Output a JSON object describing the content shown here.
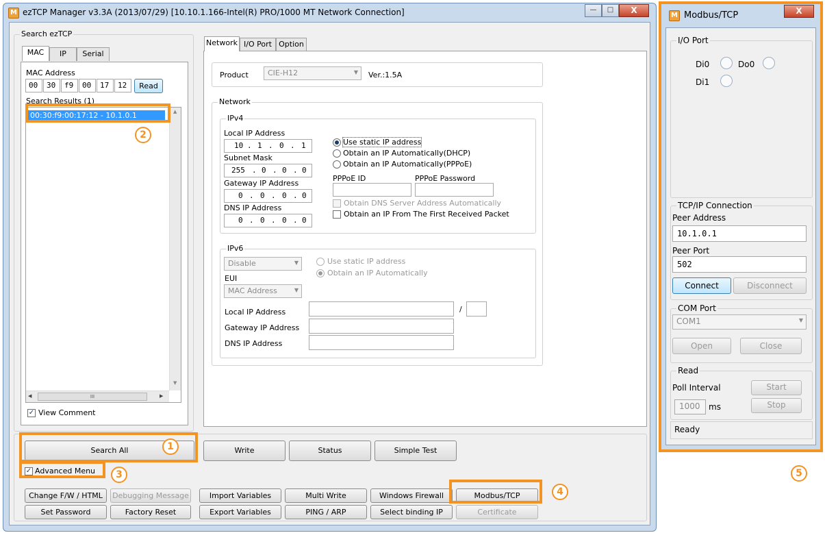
{
  "main_window": {
    "title": "ezTCP Manager v3.3A (2013/07/29) [10.10.1.166-Intel(R) PRO/1000 MT Network Connection]",
    "search": {
      "group_label": "Search ezTCP",
      "tabs": [
        "MAC",
        "IP",
        "Serial"
      ],
      "mac_label": "MAC Address",
      "mac_octets": [
        "00",
        "30",
        "f9",
        "00",
        "17",
        "12"
      ],
      "read_label": "Read",
      "results_label": "Search Results (1)",
      "results": [
        "00:30:f9:00:17:12 - 10.1.0.1"
      ],
      "view_comment": "View Comment",
      "hscroll_mark": "III"
    },
    "tabs": [
      "Network",
      "I/O Port",
      "Option"
    ],
    "product": {
      "label": "Product",
      "value": "CIE-H12",
      "version": "Ver.:1.5A"
    },
    "network": {
      "group_label": "Network",
      "ipv4": {
        "label": "IPv4",
        "local_ip_label": "Local IP Address",
        "local_ip": [
          "10",
          "1",
          "0",
          "1"
        ],
        "subnet_label": "Subnet Mask",
        "subnet": [
          "255",
          "0",
          "0",
          "0"
        ],
        "gateway_label": "Gateway IP Address",
        "gateway": [
          "0",
          "0",
          "0",
          "0"
        ],
        "dns_label": "DNS IP Address",
        "dns": [
          "0",
          "0",
          "0",
          "0"
        ],
        "radio_static": "Use static IP address",
        "radio_dhcp": "Obtain an IP Automatically(DHCP)",
        "radio_pppoe": "Obtain an IP Automatically(PPPoE)",
        "pppoe_id_label": "PPPoE ID",
        "pppoe_pw_label": "PPPoE Password",
        "chk_dns_auto": "Obtain DNS Server Address Automatically",
        "chk_first_packet": "Obtain an IP From The First Received Packet"
      },
      "ipv6": {
        "label": "IPv6",
        "mode": "Disable",
        "eui_label": "EUI",
        "eui": "MAC Address",
        "radio_static": "Use static IP address",
        "radio_auto": "Obtain an IP Automatically",
        "local_ip_label": "Local IP Address",
        "prefix_sep": "/",
        "gateway_label": "Gateway IP Address",
        "dns_label": "DNS IP Address"
      }
    },
    "buttons": {
      "search_all": "Search All",
      "write": "Write",
      "status": "Status",
      "simple_test": "Simple Test",
      "advanced_menu": "Advanced Menu",
      "change_fw": "Change F/W / HTML",
      "debugging": "Debugging Message",
      "import_vars": "Import Variables",
      "multi_write": "Multi Write",
      "win_firewall": "Windows Firewall",
      "modbus_tcp": "Modbus/TCP",
      "set_password": "Set Password",
      "factory_reset": "Factory Reset",
      "export_vars": "Export Variables",
      "ping_arp": "PING / ARP",
      "select_binding": "Select binding IP",
      "certificate": "Certificate"
    }
  },
  "modbus_window": {
    "title": "Modbus/TCP",
    "io_port": {
      "label": "I/O Port",
      "di0": "Di0",
      "do0": "Do0",
      "di1": "Di1"
    },
    "tcp": {
      "label": "TCP/IP Connection",
      "peer_address_label": "Peer Address",
      "peer_address": "10.1.0.1",
      "peer_port_label": "Peer Port",
      "peer_port": "502",
      "connect": "Connect",
      "disconnect": "Disconnect"
    },
    "com": {
      "label": "COM Port",
      "port": "COM1",
      "open": "Open",
      "close": "Close"
    },
    "read": {
      "label": "Read",
      "poll_label": "Poll Interval",
      "poll_value": "1000",
      "unit": "ms",
      "start": "Start",
      "stop": "Stop"
    },
    "status": "Ready"
  },
  "annotations": [
    "1",
    "2",
    "3",
    "4",
    "5"
  ],
  "colors": {
    "annotation": "#f39323",
    "selection": "#3399ff",
    "title_bg": "#c9daec"
  }
}
